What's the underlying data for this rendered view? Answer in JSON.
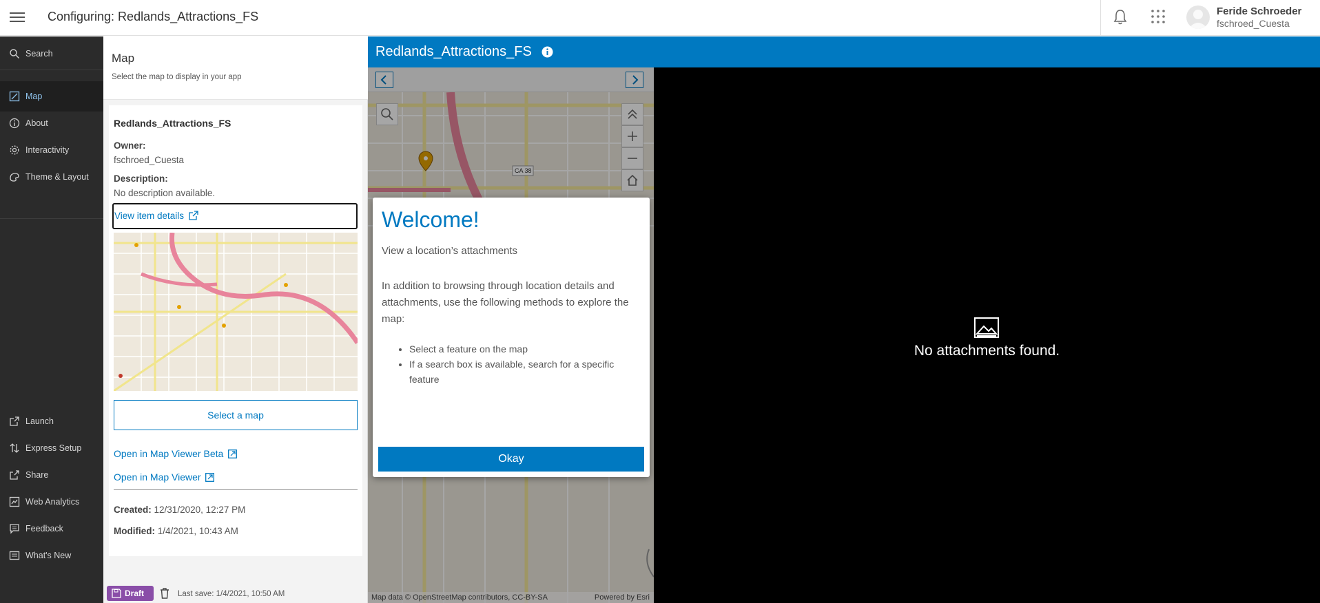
{
  "header": {
    "title": "Configuring: Redlands_Attractions_FS",
    "user_name": "Feride Schroeder",
    "user_id": "fschroed_Cuesta"
  },
  "nav": {
    "search": "Search",
    "items": [
      {
        "label": "Map",
        "icon": "map-edit-icon"
      },
      {
        "label": "About",
        "icon": "info-icon"
      },
      {
        "label": "Interactivity",
        "icon": "gear-icon"
      },
      {
        "label": "Theme & Layout",
        "icon": "palette-icon"
      }
    ],
    "bottom_items": [
      {
        "label": "Launch",
        "icon": "launch-icon"
      },
      {
        "label": "Express Setup",
        "icon": "sort-arrows-icon"
      },
      {
        "label": "Share",
        "icon": "share-icon"
      },
      {
        "label": "Web Analytics",
        "icon": "analytics-icon"
      },
      {
        "label": "Feedback",
        "icon": "feedback-icon"
      },
      {
        "label": "What's New",
        "icon": "whats-new-icon"
      }
    ]
  },
  "panel": {
    "title": "Map",
    "subtitle": "Select the map to display in your app",
    "map_name": "Redlands_Attractions_FS",
    "owner_label": "Owner:",
    "owner_value": "fschroed_Cuesta",
    "description_label": "Description:",
    "description_value": "No description available.",
    "view_details": "View item details",
    "select_map": "Select a map",
    "open_beta": "Open in Map Viewer Beta",
    "open_viewer": "Open in Map Viewer",
    "created_label": "Created:",
    "created_value": "12/31/2020, 12:27 PM",
    "modified_label": "Modified:",
    "modified_value": "1/4/2021, 10:43 AM",
    "draft": "Draft",
    "last_save": "Last save: 1/4/2021, 10:50 AM"
  },
  "app": {
    "title": "Redlands_Attractions_FS",
    "attribution": "Map data © OpenStreetMap contributors, CC-BY-SA",
    "powered_by": "Powered by Esri",
    "map_label_ca38": "CA 38",
    "no_attachments": "No attachments found."
  },
  "modal": {
    "title": "Welcome!",
    "subtitle": "View a location’s attachments",
    "body": "In addition to browsing through location details and attachments, use the following methods to explore the map:",
    "list": [
      "Select a feature on the map",
      "If a search box is available, search for a specific feature"
    ],
    "button": "Okay"
  },
  "colors": {
    "accent": "#0079c1",
    "nav_bg": "#2b2b2b",
    "draft": "#8a4ea8"
  }
}
